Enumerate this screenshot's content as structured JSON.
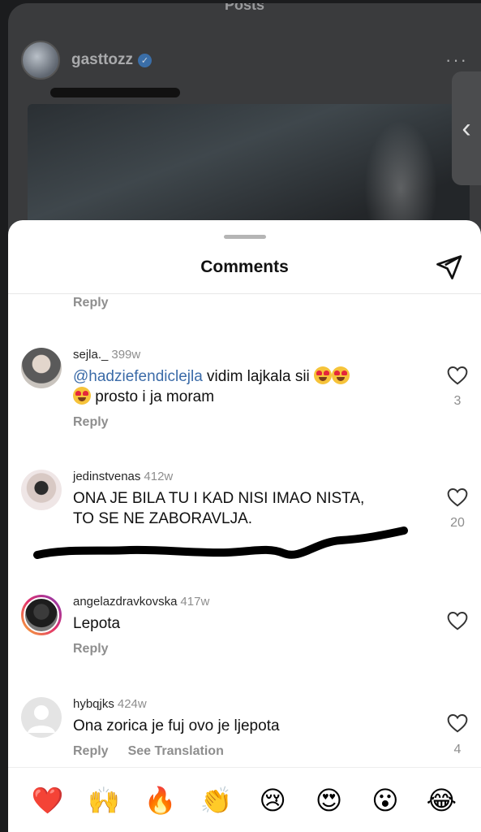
{
  "background_post": {
    "screen_title": "Posts",
    "username": "gasttozz",
    "verified": true
  },
  "sheet": {
    "title": "Comments",
    "reply_label": "Reply",
    "see_translation_label": "See Translation"
  },
  "comments": [
    {
      "user": "sejla._",
      "time": "399w",
      "mention": "@hadziefendiclejla",
      "text_after_mention": " vidim lajkala sii",
      "text_line2": " prosto i ja moram",
      "likes": "3"
    },
    {
      "user": "jedinstvenas",
      "time": "412w",
      "text": "ONA JE BILA TU I KAD NISI IMAO NISTA, TO SE NE ZABORAVLJA.",
      "likes": "20"
    },
    {
      "user": "angelazdravkovska",
      "time": "417w",
      "text": "Lepota",
      "likes": ""
    },
    {
      "user": "hybqjks",
      "time": "424w",
      "text": "Ona zorica je fuj ovo je ljepota",
      "likes": "4"
    }
  ],
  "reactions": [
    {
      "name": "red-heart",
      "glyph": "❤️"
    },
    {
      "name": "raising-hands",
      "glyph": "🙌"
    },
    {
      "name": "fire",
      "glyph": "🔥"
    },
    {
      "name": "clapping-hands",
      "glyph": "👏"
    },
    {
      "name": "crying-face",
      "glyph": "😢"
    },
    {
      "name": "heart-eyes",
      "glyph": "😍"
    },
    {
      "name": "astonished-face",
      "glyph": "😮"
    },
    {
      "name": "tears-of-joy",
      "glyph": "😂"
    }
  ],
  "colors": {
    "mention": "#3b6ba8",
    "muted": "#8e8e8e",
    "sheet_bg": "#ffffff"
  }
}
